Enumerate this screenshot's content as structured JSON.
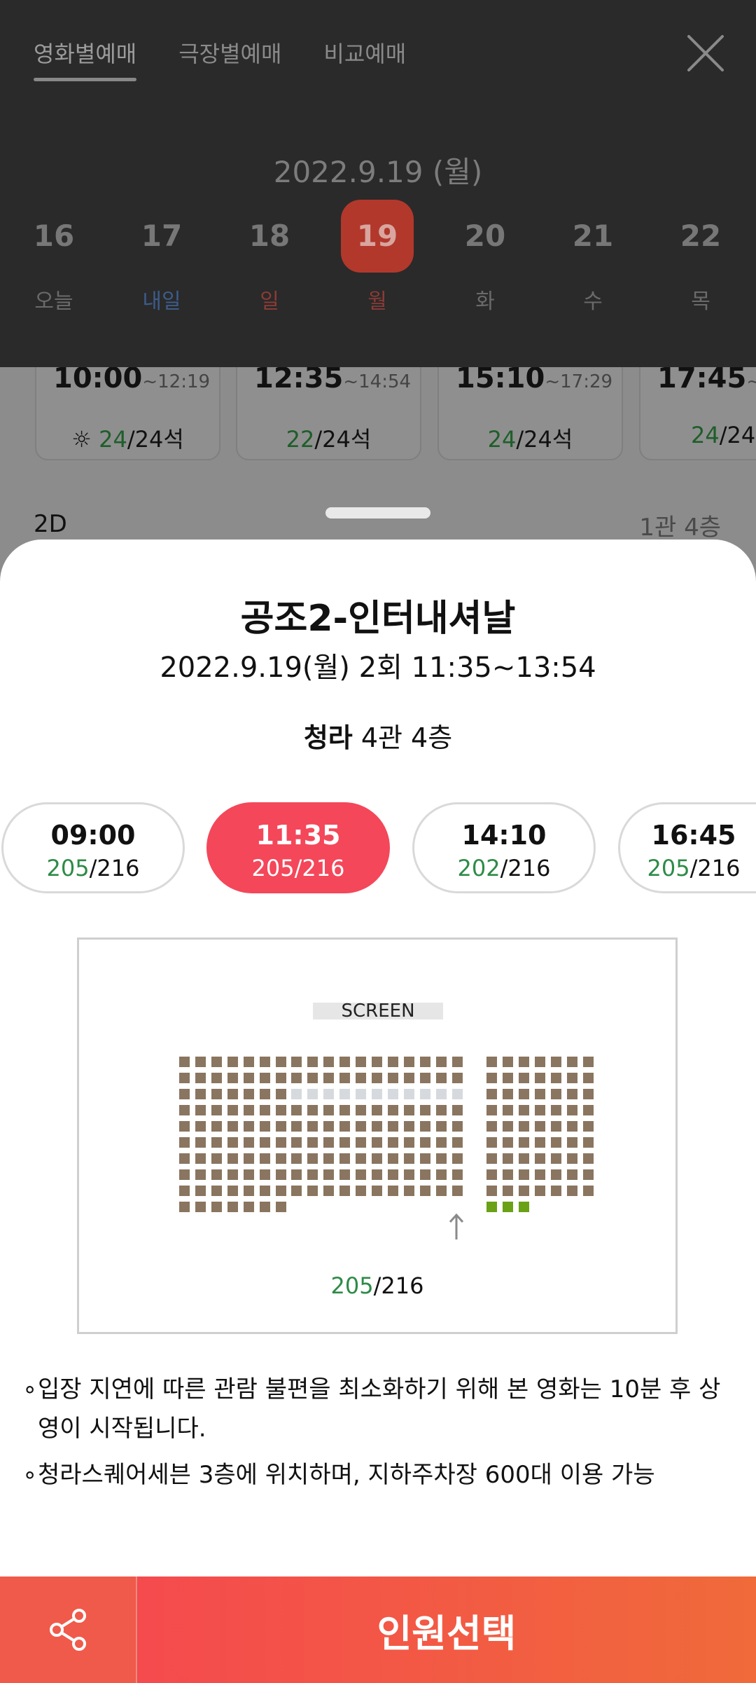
{
  "header": {
    "tabs": [
      {
        "label": "영화별예매"
      },
      {
        "label": "극장별예매"
      },
      {
        "label": "비교예매"
      }
    ],
    "date_title": "2022.9.19 (월)",
    "days": [
      {
        "num": "16",
        "weekday": "오늘"
      },
      {
        "num": "17",
        "weekday": "내일"
      },
      {
        "num": "18",
        "weekday": "일"
      },
      {
        "num": "19",
        "weekday": "월"
      },
      {
        "num": "20",
        "weekday": "화"
      },
      {
        "num": "21",
        "weekday": "수"
      },
      {
        "num": "22",
        "weekday": "목"
      }
    ]
  },
  "background": {
    "cards": [
      {
        "start": "10:00",
        "end": "~12:19",
        "avail": "24",
        "total": "/24석"
      },
      {
        "start": "12:35",
        "end": "~14:54",
        "avail": "22",
        "total": "/24석"
      },
      {
        "start": "15:10",
        "end": "~17:29",
        "avail": "24",
        "total": "/24석"
      },
      {
        "start": "17:45",
        "end": "~",
        "avail": "24",
        "total": "/24"
      }
    ],
    "format": "2D",
    "hall": "1관 4층"
  },
  "sheet": {
    "title": "공조2-인터내셔날",
    "info": "2022.9.19(월) 2회 11:35~13:54",
    "theater": "청라",
    "hall": " 4관 4층",
    "times": [
      {
        "time": "09:00",
        "avail": "205",
        "total": "/216"
      },
      {
        "time": "11:35",
        "avail": "205",
        "total": "/216"
      },
      {
        "time": "14:10",
        "avail": "202",
        "total": "/216"
      },
      {
        "time": "16:45",
        "avail": "205",
        "total": "/216"
      }
    ],
    "screen_label": "SCREEN",
    "seat_avail": "205",
    "seat_total": "/216",
    "notes": [
      "입장 지연에 따른 관람 불편을 최소화하기 위해 본 영화는 10분 후 상영이 시작됩니다.",
      "청라스퀘어세븐 3층에 위치하며, 지하주차장 600대 이용 가능"
    ]
  },
  "bottom": {
    "select_label": "인원선택"
  },
  "colors": {
    "accent": "#f4475a",
    "available": "#2e8b48",
    "seat": "#8a7560",
    "seat_taken": "#d6d9de",
    "seat_special": "#6aa117"
  }
}
